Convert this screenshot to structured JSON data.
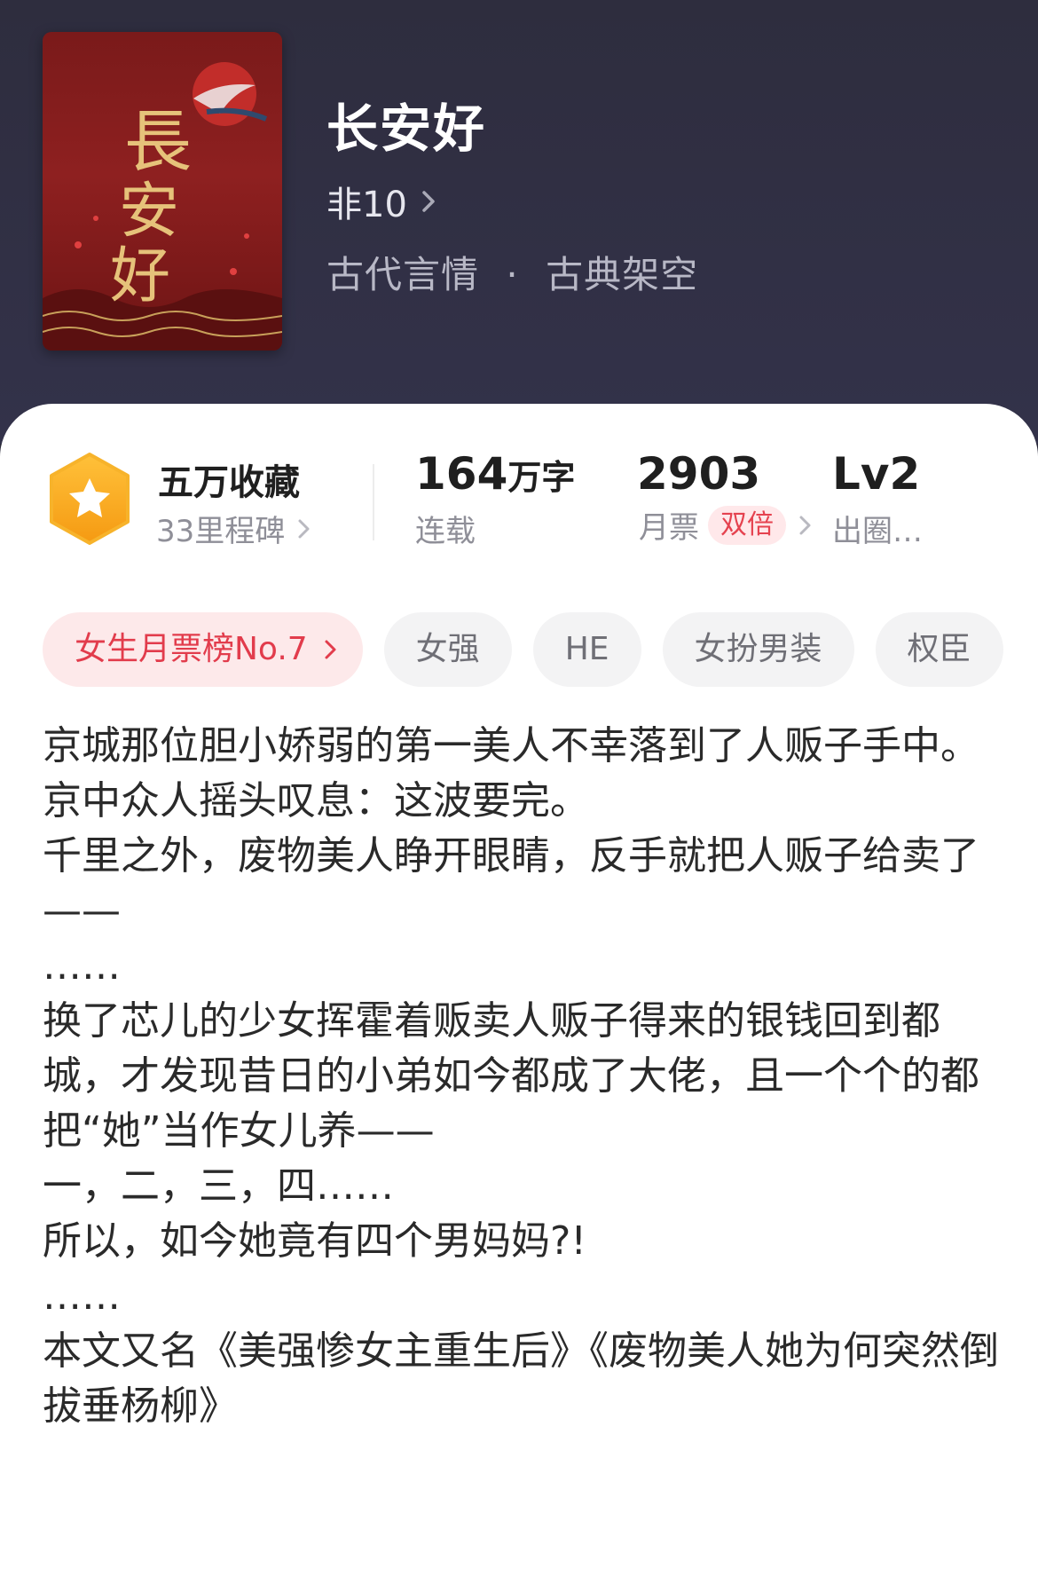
{
  "book": {
    "title": "长安好",
    "author": "非10",
    "genre_primary": "古代言情",
    "genre_separator": "·",
    "genre_secondary": "古典架空",
    "cover_text": "長安好"
  },
  "stats": {
    "collect_label": "五万收藏",
    "milestone_label": "33里程碑",
    "wordcount_value": "164",
    "wordcount_unit": "万字",
    "status_label": "连载",
    "monthly_votes_value": "2903",
    "monthly_votes_label": "月票",
    "double_badge": "双倍",
    "level_value": "Lv2",
    "level_label": "出圈…"
  },
  "tags": [
    {
      "label": "女生月票榜No.7"
    },
    {
      "label": "女强"
    },
    {
      "label": "HE"
    },
    {
      "label": "女扮男装"
    },
    {
      "label": "权臣"
    }
  ],
  "synopsis": [
    "京城那位胆小娇弱的第一美人不幸落到了人贩子手中。",
    "京中众人摇头叹息：这波要完。",
    "千里之外，废物美人睁开眼睛，反手就把人贩子给卖了——",
    "……",
    "换了芯儿的少女挥霍着贩卖人贩子得来的银钱回到都城，才发现昔日的小弟如今都成了大佬，且一个个的都把“她”当作女儿养——",
    "一，二，三，四……",
    "所以，如今她竟有四个男妈妈?!",
    "……",
    "本文又名《美强惨女主重生后》《废物美人她为何突然倒拔垂杨柳》"
  ],
  "colors": {
    "hero_bg": "#2e2d3e",
    "accent_red": "#e23c4c",
    "badge_orange": "#f7a21b",
    "cover_red": "#8e2020"
  },
  "icons": {
    "author_chevron": "chevron-right-icon",
    "badge": "star-hexagon-icon"
  }
}
